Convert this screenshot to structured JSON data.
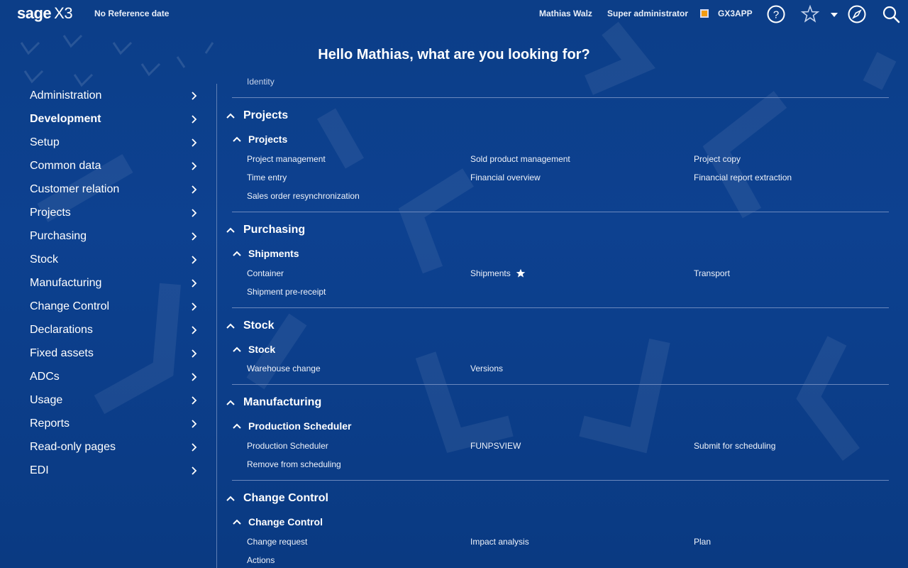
{
  "header": {
    "logo_brand": "sage",
    "logo_product": "X3",
    "reference_date": "No Reference date",
    "user_name": "Mathias Walz",
    "role": "Super administrator",
    "folder": "GX3APP",
    "icons": [
      "help-icon",
      "star-icon",
      "dropdown-icon",
      "compass-icon",
      "search-icon"
    ]
  },
  "greeting": "Hello Mathias, what are you looking for?",
  "sidebar": {
    "items": [
      {
        "label": "Administration",
        "active": false
      },
      {
        "label": "Development",
        "active": true
      },
      {
        "label": "Setup",
        "active": false
      },
      {
        "label": "Common data",
        "active": false
      },
      {
        "label": "Customer relation",
        "active": false
      },
      {
        "label": "Projects",
        "active": false
      },
      {
        "label": "Purchasing",
        "active": false
      },
      {
        "label": "Stock",
        "active": false
      },
      {
        "label": "Manufacturing",
        "active": false
      },
      {
        "label": "Change Control",
        "active": false
      },
      {
        "label": "Declarations",
        "active": false
      },
      {
        "label": "Fixed assets",
        "active": false
      },
      {
        "label": "ADCs",
        "active": false
      },
      {
        "label": "Usage",
        "active": false
      },
      {
        "label": "Reports",
        "active": false
      },
      {
        "label": "Read-only pages",
        "active": false
      },
      {
        "label": "EDI",
        "active": false
      }
    ]
  },
  "main": {
    "cut_off_item": "Identity",
    "sections": [
      {
        "title": "Projects",
        "subsection": "Projects",
        "links": [
          "Project management",
          "Sold product management",
          "Project copy",
          "Time entry",
          "Financial overview",
          "Financial report extraction",
          "Sales order resynchronization"
        ]
      },
      {
        "title": "Purchasing",
        "subsection": "Shipments",
        "links": [
          "Container",
          "Shipments",
          "Transport",
          "Shipment pre-receipt"
        ]
      },
      {
        "title": "Stock",
        "subsection": "Stock",
        "links": [
          "Warehouse change",
          "Versions"
        ]
      },
      {
        "title": "Manufacturing",
        "subsection": "Production Scheduler",
        "links": [
          "Production Scheduler",
          "FUNPSVIEW",
          "Submit for scheduling",
          "Remove from scheduling"
        ]
      },
      {
        "title": "Change Control",
        "subsection": "Change Control",
        "links": [
          "Change request",
          "Impact analysis",
          "Plan",
          "Actions"
        ]
      }
    ]
  },
  "colors": {
    "background": "#0d4190",
    "folder_badge": "#f39c12",
    "divider": "#6b88bd"
  }
}
